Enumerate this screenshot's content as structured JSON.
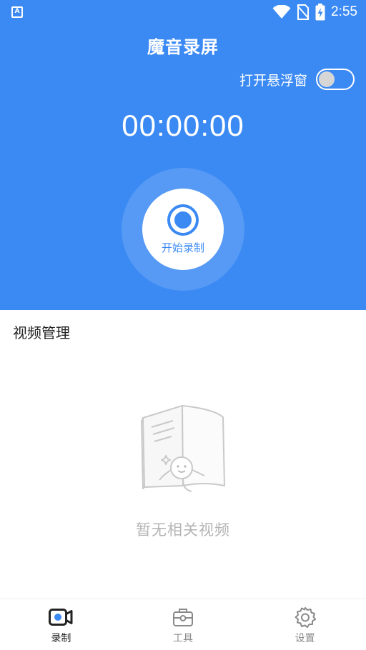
{
  "status_bar": {
    "app_badge": "A",
    "time": "2:55",
    "icons": [
      "app-notification-icon",
      "wifi-icon",
      "no-sim-icon",
      "battery-charging-icon"
    ]
  },
  "header": {
    "title": "魔音录屏",
    "floating_window_label": "打开悬浮窗",
    "floating_window_enabled": false
  },
  "recorder": {
    "timer": "00:00:00",
    "start_label": "开始录制"
  },
  "video_section": {
    "title": "视频管理",
    "empty_text": "暂无相关视频"
  },
  "tabs": [
    {
      "label": "录制",
      "icon": "video-camera-icon",
      "active": true
    },
    {
      "label": "工具",
      "icon": "toolbox-icon",
      "active": false
    },
    {
      "label": "设置",
      "icon": "gear-icon",
      "active": false
    }
  ],
  "colors": {
    "primary": "#3b8af4",
    "text_dark": "#222222",
    "text_muted": "#8a8a8a",
    "empty_text": "#b4b4b4"
  }
}
